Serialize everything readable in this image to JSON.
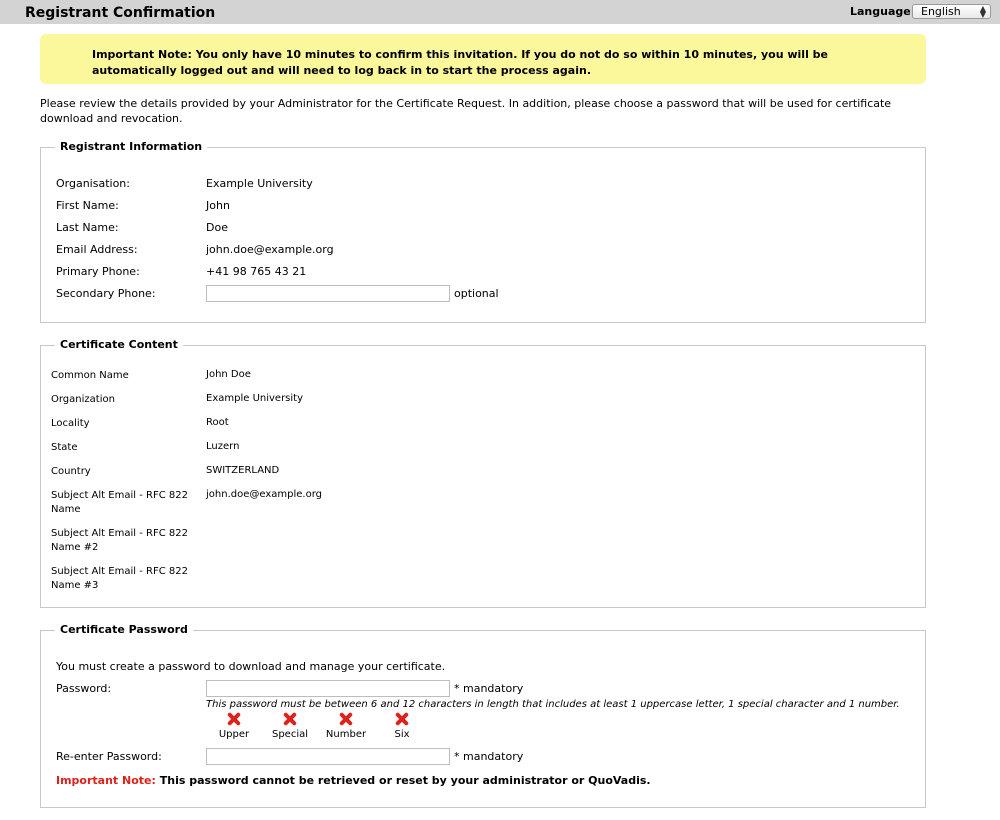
{
  "header": {
    "title": "Registrant Confirmation",
    "language_label": "Language:",
    "language_value": "English"
  },
  "notice": "Important Note: You only have 10 minutes to confirm this invitation. If you do not do so within 10 minutes, you will be automatically logged out and will need to log back in to start the process again.",
  "intro": "Please review the details provided by your Administrator for the Certificate Request. In addition, please choose a password that will be used for certificate download and revocation.",
  "registrant": {
    "legend": "Registrant Information",
    "rows": [
      {
        "label": "Organisation:",
        "value": "Example University"
      },
      {
        "label": "First Name:",
        "value": "John"
      },
      {
        "label": "Last Name:",
        "value": "Doe"
      },
      {
        "label": "Email Address:",
        "value": "john.doe@example.org"
      },
      {
        "label": "Primary Phone:",
        "value": "+41 98 765 43 21"
      }
    ],
    "secondary_phone_label": "Secondary Phone:",
    "secondary_phone_value": "",
    "secondary_phone_note": "optional"
  },
  "certificate": {
    "legend": "Certificate Content",
    "rows": [
      {
        "label": "Common Name",
        "value": "John Doe"
      },
      {
        "label": "Organization",
        "value": "Example University"
      },
      {
        "label": "Locality",
        "value": "Root"
      },
      {
        "label": "State",
        "value": "Luzern"
      },
      {
        "label": "Country",
        "value": "SWITZERLAND"
      },
      {
        "label": "Subject Alt Email - RFC 822 Name",
        "value": "john.doe@example.org"
      },
      {
        "label": "Subject Alt Email - RFC 822 Name #2",
        "value": ""
      },
      {
        "label": "Subject Alt Email - RFC 822 Name #3",
        "value": ""
      }
    ]
  },
  "password": {
    "legend": "Certificate Password",
    "instruction": "You must create a password to download and manage your certificate.",
    "password_label": "Password:",
    "password_value": "",
    "mandatory": "* mandatory",
    "hint": "This password must be between 6 and 12 characters in length that includes at least 1 uppercase letter, 1 special character and 1 number.",
    "requirements": [
      {
        "label": "Upper",
        "icon": "red-x-icon"
      },
      {
        "label": "Special",
        "icon": "red-x-icon"
      },
      {
        "label": "Number",
        "icon": "red-x-icon"
      },
      {
        "label": "Six",
        "icon": "red-x-icon"
      }
    ],
    "reenter_label": "Re-enter Password:",
    "reenter_value": "",
    "final_note_red": "Important Note:",
    "final_note_rest": " This password cannot be retrieved or reset by your administrator or QuoVadis."
  },
  "colors": {
    "topbar": "#d3d3d3",
    "notice_bg": "#fbf89c",
    "error_red": "#e0211b"
  }
}
